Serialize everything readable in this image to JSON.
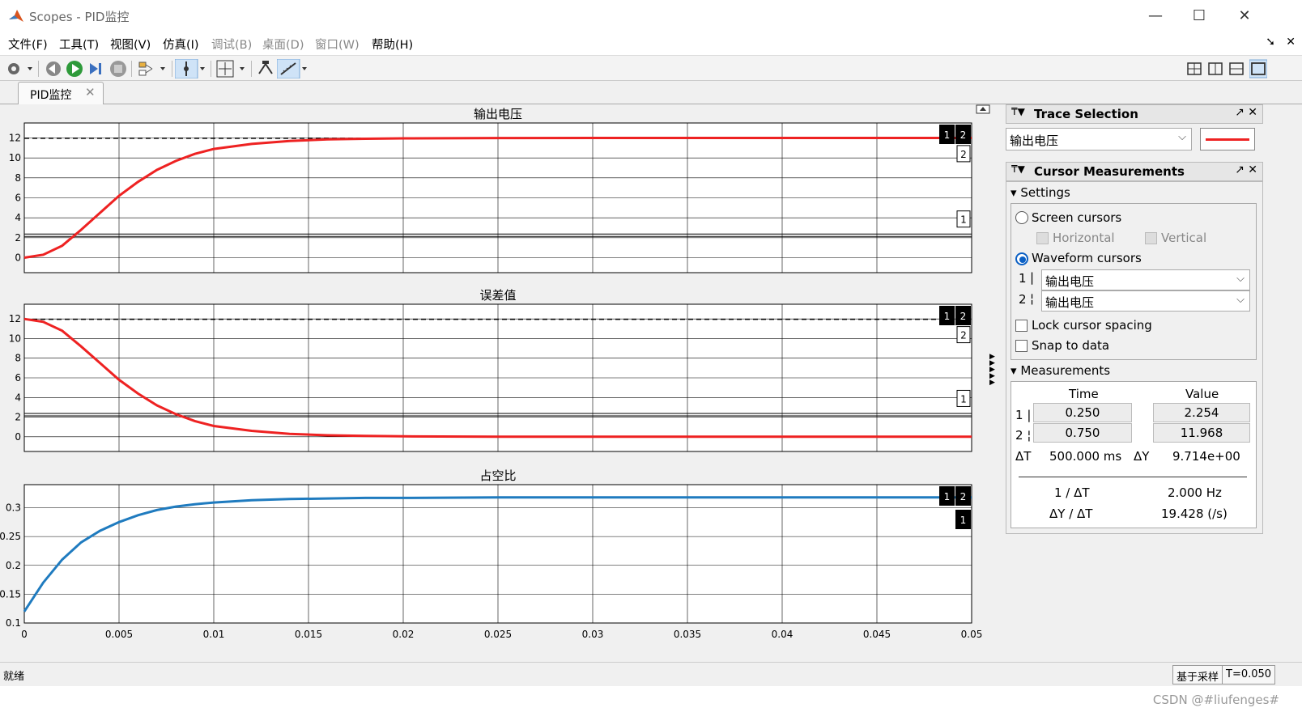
{
  "window": {
    "title": "Scopes - PID监控",
    "min": "—",
    "max": "☐",
    "close": "✕"
  },
  "menu": [
    {
      "label": "文件(F)",
      "enabled": true
    },
    {
      "label": "工具(T)",
      "enabled": true
    },
    {
      "label": "视图(V)",
      "enabled": true
    },
    {
      "label": "仿真(I)",
      "enabled": true
    },
    {
      "label": "调试(B)",
      "enabled": false
    },
    {
      "label": "桌面(D)",
      "enabled": false
    },
    {
      "label": "窗口(W)",
      "enabled": false
    },
    {
      "label": "帮助(H)",
      "enabled": true
    }
  ],
  "tab": {
    "label": "PID监控",
    "close": "✕"
  },
  "colors": {
    "red": "#ee2222",
    "blue": "#1f7bbf"
  },
  "chart_data": [
    {
      "type": "line",
      "title": "输出电压",
      "xlim": [
        0,
        0.05
      ],
      "ylim": [
        -1.5,
        13.5
      ],
      "yticks": [
        0,
        2,
        4,
        6,
        8,
        10,
        12
      ],
      "ytick_labels": [
        "0",
        "2",
        "4",
        "6",
        "8",
        "10",
        "12"
      ],
      "grid": true,
      "series": [
        {
          "color": "#ee2222",
          "x": [
            0,
            0.001,
            0.002,
            0.003,
            0.004,
            0.005,
            0.006,
            0.007,
            0.008,
            0.009,
            0.01,
            0.012,
            0.014,
            0.016,
            0.018,
            0.02,
            0.025,
            0.03,
            0.035,
            0.04,
            0.045,
            0.05
          ],
          "y": [
            0,
            0.3,
            1.2,
            2.8,
            4.5,
            6.2,
            7.6,
            8.8,
            9.7,
            10.4,
            10.9,
            11.4,
            11.7,
            11.85,
            11.92,
            11.96,
            11.99,
            12,
            12,
            12,
            12,
            12
          ]
        }
      ],
      "cursors": [
        {
          "label": "1",
          "y": 2.254
        },
        {
          "label": "2",
          "y": 11.968
        }
      ]
    },
    {
      "type": "line",
      "title": "误差值",
      "xlim": [
        0,
        0.05
      ],
      "ylim": [
        -1.5,
        13.5
      ],
      "yticks": [
        0,
        2,
        4,
        6,
        8,
        10,
        12
      ],
      "ytick_labels": [
        "0",
        "2",
        "4",
        "6",
        "8",
        "10",
        "12"
      ],
      "grid": true,
      "series": [
        {
          "color": "#ee2222",
          "x": [
            0,
            0.001,
            0.002,
            0.003,
            0.004,
            0.005,
            0.006,
            0.007,
            0.008,
            0.009,
            0.01,
            0.012,
            0.014,
            0.016,
            0.018,
            0.02,
            0.025,
            0.03,
            0.035,
            0.04,
            0.045,
            0.05
          ],
          "y": [
            12,
            11.7,
            10.8,
            9.2,
            7.5,
            5.8,
            4.4,
            3.2,
            2.3,
            1.6,
            1.1,
            0.6,
            0.3,
            0.15,
            0.08,
            0.04,
            0.01,
            0,
            0,
            0,
            0,
            0
          ]
        }
      ],
      "cursors": [
        {
          "label": "1",
          "y": 2.254
        },
        {
          "label": "2",
          "y": 11.968
        }
      ]
    },
    {
      "type": "line",
      "title": "占空比",
      "xlim": [
        0,
        0.05
      ],
      "ylim": [
        0.1,
        0.34
      ],
      "yticks": [
        0.1,
        0.15,
        0.2,
        0.25,
        0.3
      ],
      "ytick_labels": [
        "0.1",
        "0.15",
        "0.2",
        "0.25",
        "0.3"
      ],
      "xticks": [
        0,
        0.005,
        0.01,
        0.015,
        0.02,
        0.025,
        0.03,
        0.035,
        0.04,
        0.045,
        0.05
      ],
      "xtick_labels": [
        "0",
        "0.005",
        "0.01",
        "0.015",
        "0.02",
        "0.025",
        "0.03",
        "0.035",
        "0.04",
        "0.045",
        "0.05"
      ],
      "grid": true,
      "series": [
        {
          "color": "#1f7bbf",
          "x": [
            0,
            0.001,
            0.002,
            0.003,
            0.004,
            0.005,
            0.006,
            0.007,
            0.008,
            0.009,
            0.01,
            0.012,
            0.014,
            0.016,
            0.018,
            0.02,
            0.025,
            0.03,
            0.035,
            0.04,
            0.045,
            0.05
          ],
          "y": [
            0.12,
            0.17,
            0.21,
            0.24,
            0.26,
            0.275,
            0.287,
            0.296,
            0.302,
            0.306,
            0.309,
            0.313,
            0.315,
            0.316,
            0.317,
            0.317,
            0.318,
            0.318,
            0.318,
            0.318,
            0.318,
            0.318
          ]
        }
      ],
      "cursor_tags": [
        "1",
        "2"
      ]
    }
  ],
  "trace_selection": {
    "title": "Trace Selection",
    "value": "输出电压"
  },
  "cursor_measurements": {
    "title": "Cursor Measurements",
    "settings_label": "Settings",
    "screen_cursors": "Screen cursors",
    "horizontal": "Horizontal",
    "vertical": "Vertical",
    "waveform_cursors": "Waveform cursors",
    "cursor1_label": "1",
    "cursor1_signal": "输出电压",
    "cursor2_label": "2",
    "cursor2_signal": "输出电压",
    "lock_spacing": "Lock cursor spacing",
    "snap_to_data": "Snap to data",
    "measurements_label": "Measurements",
    "time_header": "Time",
    "value_header": "Value",
    "row1_label": "1",
    "row1_time": "0.250",
    "row1_value": "2.254",
    "row2_label": "2",
    "row2_time": "0.750",
    "row2_value": "11.968",
    "dT_label": "ΔT",
    "dT_value": "500.000 ms",
    "dY_label": "ΔY",
    "dY_value": "9.714e+00",
    "inv_dT_label": "1 / ΔT",
    "inv_dT_value": "2.000 Hz",
    "dYdT_label": "ΔY / ΔT",
    "dYdT_value": "19.428 (/s)"
  },
  "status": {
    "left": "就绪",
    "mode": "基于采样",
    "time": "T=0.050"
  },
  "watermark": "CSDN @#liufenges#"
}
